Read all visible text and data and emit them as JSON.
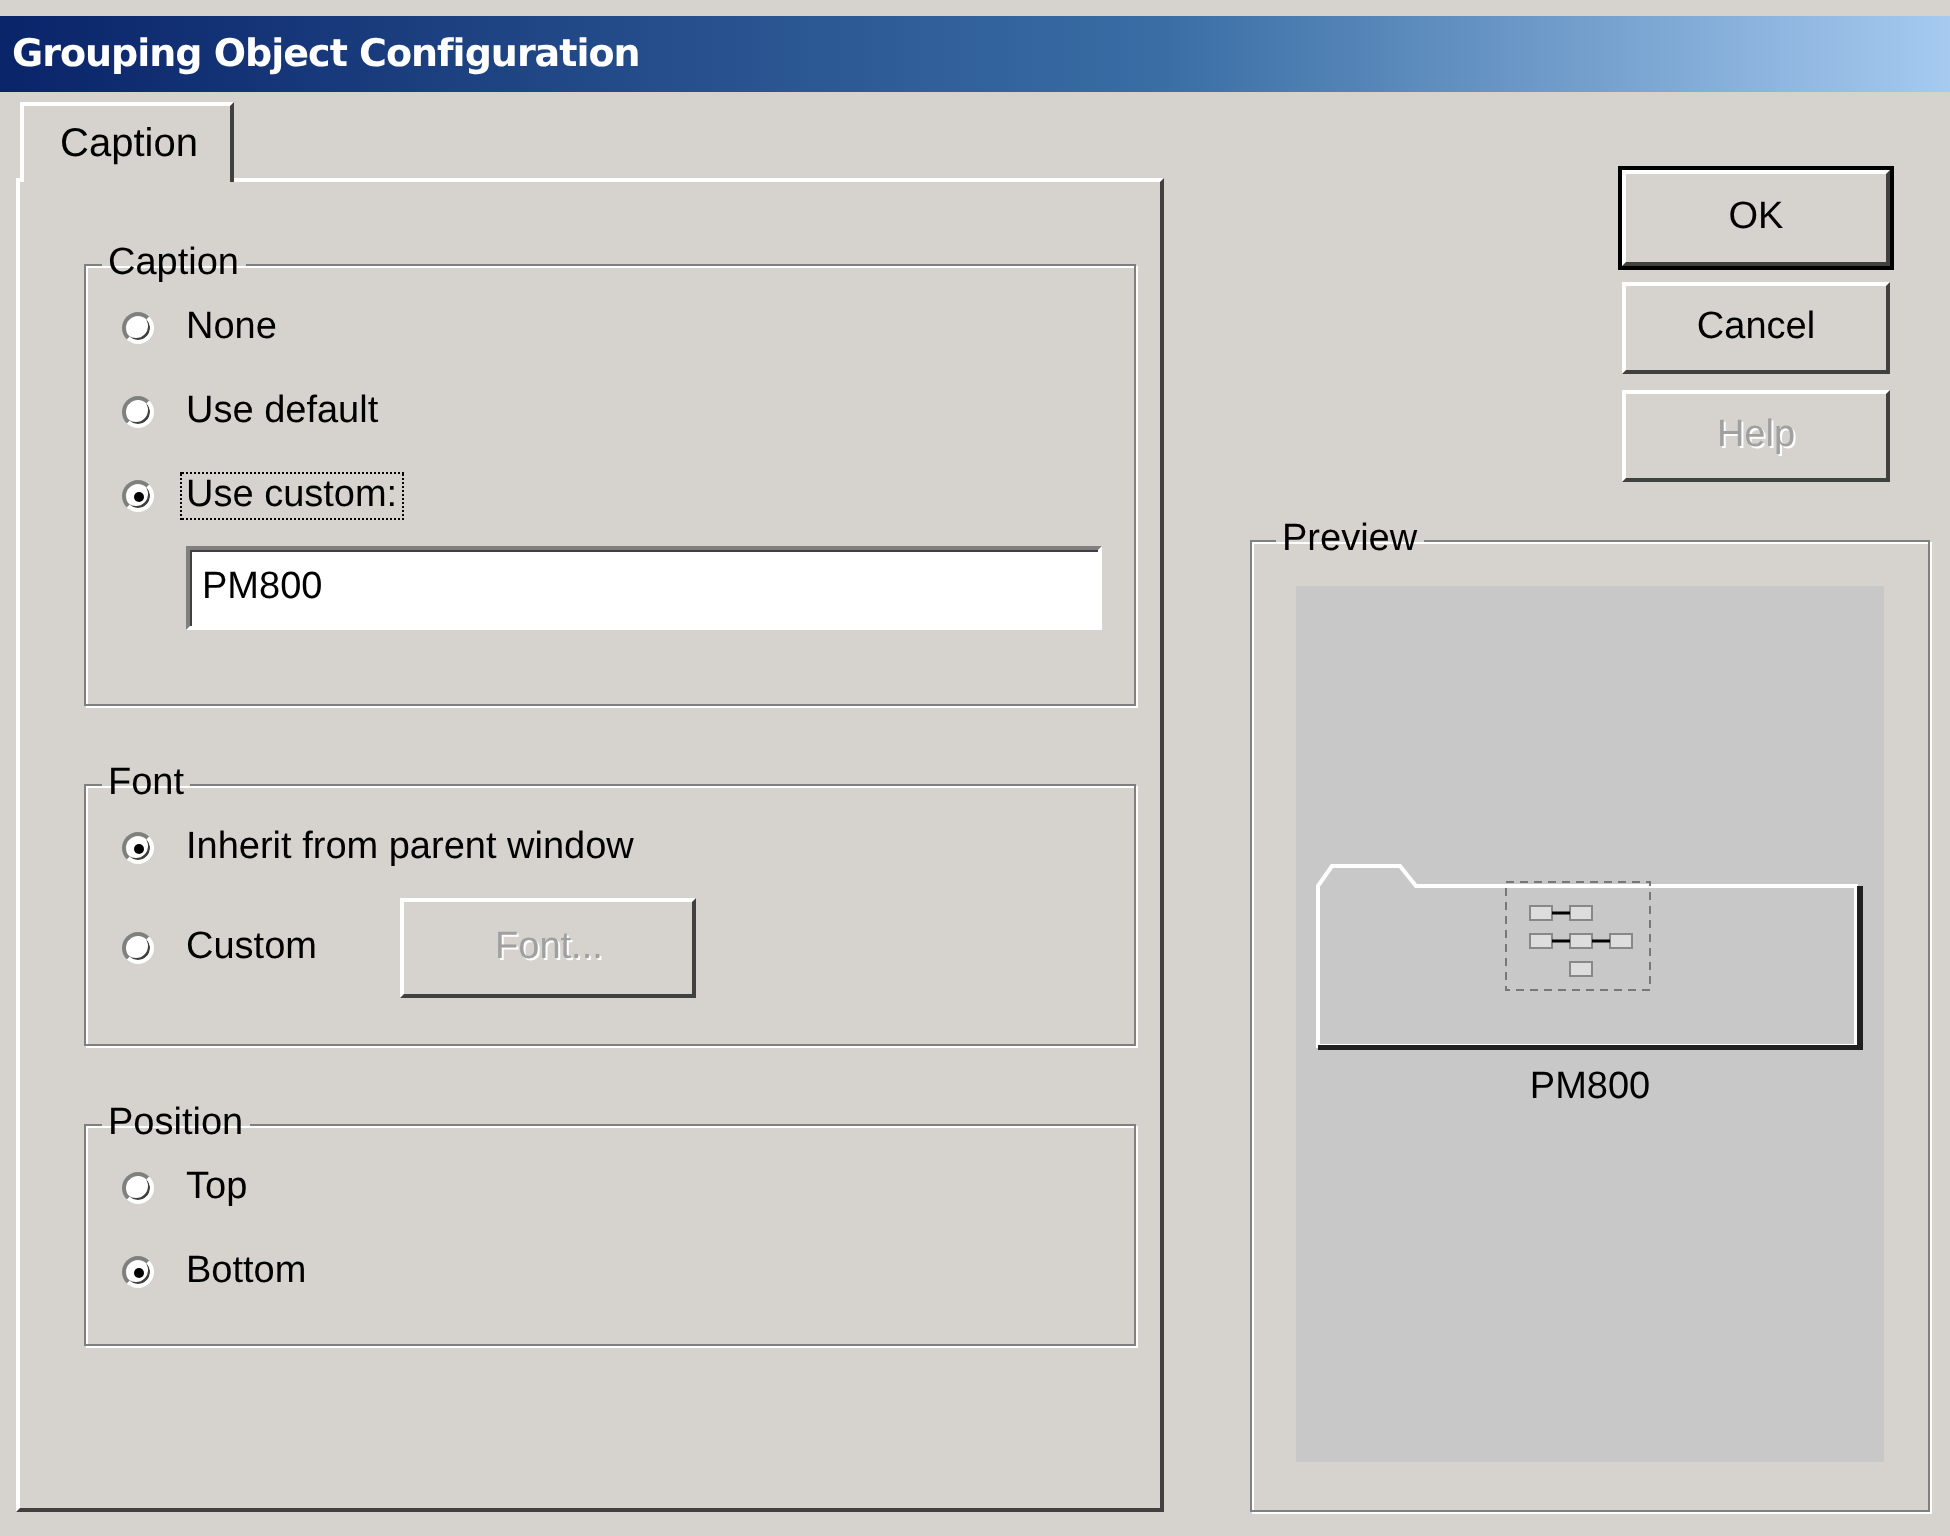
{
  "window": {
    "title": "Grouping Object Configuration"
  },
  "tabs": [
    {
      "label": "Caption",
      "selected": true
    }
  ],
  "groups": [
    {
      "title": "Caption",
      "options": [
        {
          "label": "None",
          "selected": false,
          "focused": false
        },
        {
          "label": "Use default",
          "selected": false,
          "focused": false
        },
        {
          "label": "Use custom:",
          "selected": true,
          "focused": true,
          "field": {
            "value": "PM800"
          }
        }
      ]
    },
    {
      "title": "Font",
      "options": [
        {
          "label": "Inherit from parent window",
          "selected": true,
          "focused": false
        },
        {
          "label": "Custom",
          "selected": false,
          "focused": false,
          "button": {
            "label": "Font...",
            "disabled": true
          }
        }
      ]
    },
    {
      "title": "Position",
      "options": [
        {
          "label": "Top",
          "selected": false,
          "focused": false
        },
        {
          "label": "Bottom",
          "selected": true,
          "focused": false
        }
      ]
    }
  ],
  "buttons": [
    {
      "label": "OK",
      "default": true,
      "disabled": false
    },
    {
      "label": "Cancel",
      "default": false,
      "disabled": false
    },
    {
      "label": "Help",
      "default": false,
      "disabled": true
    }
  ],
  "preview": {
    "title": "Preview",
    "caption": "PM800"
  }
}
